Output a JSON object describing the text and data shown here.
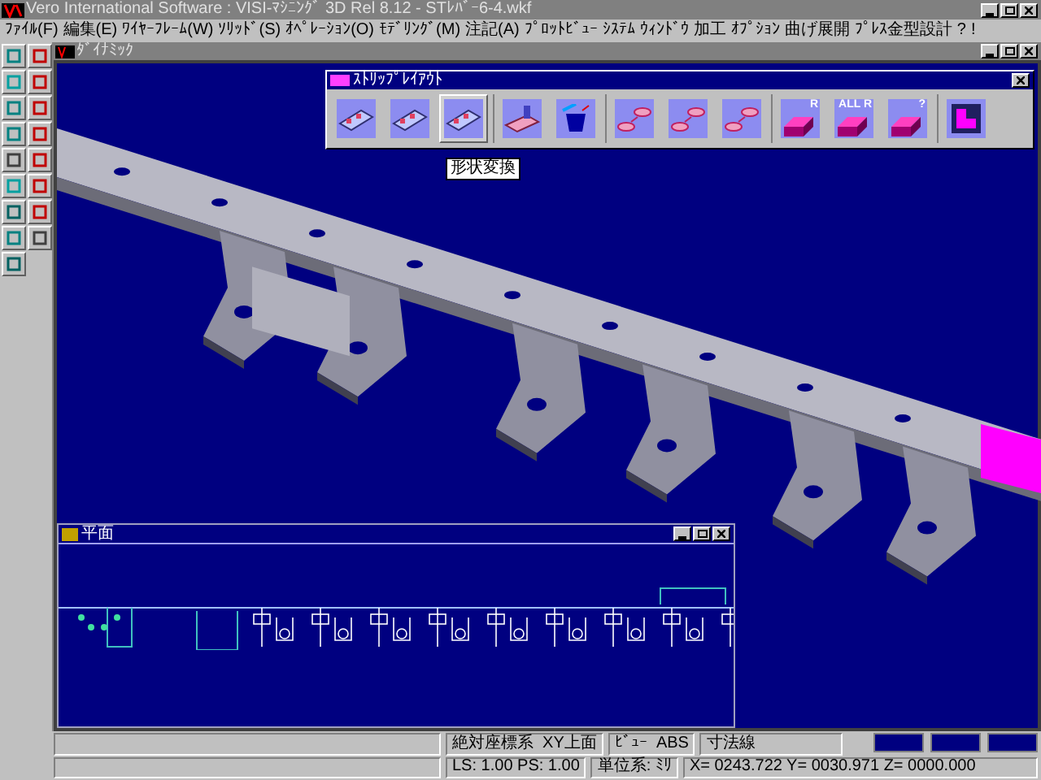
{
  "window": {
    "title": "Vero International Software : VISI-ﾏｼﾆﾝｸﾞ 3D Rel 8.12 - STﾚﾊﾞｰ6-4.wkf"
  },
  "menu": [
    "ﾌｧｲﾙ(F)",
    "編集(E)",
    "ﾜｲﾔｰﾌﾚｰﾑ(W)",
    "ｿﾘｯﾄﾞ(S)",
    "ｵﾍﾟﾚｰｼｮﾝ(O)",
    "ﾓﾃﾞﾘﾝｸﾞ(M)",
    "注記(A)",
    "ﾌﾟﾛｯﾄﾋﾞｭｰ",
    "ｼｽﾃﾑ",
    "ｳｨﾝﾄﾞｳ",
    "加工",
    "ｵﾌﾟｼｮﾝ",
    "曲げ展開",
    "ﾌﾟﾚｽ金型設計",
    "?",
    "!"
  ],
  "viewport": {
    "title": "ﾀﾞｲﾅﾐｯｸ"
  },
  "strip_toolbar": {
    "title": "ｽﾄﾘｯﾌﾟﾚｲｱｳﾄ",
    "tooltip": "形状変換",
    "groups": [
      [
        {
          "kind": "strip",
          "hovered": false
        },
        {
          "kind": "strip",
          "hovered": false
        },
        {
          "kind": "strip",
          "hovered": true
        }
      ],
      [
        {
          "kind": "tower",
          "hovered": false
        },
        {
          "kind": "bucket",
          "hovered": false
        }
      ],
      [
        {
          "kind": "pieces",
          "hovered": false
        },
        {
          "kind": "pieces",
          "hovered": false
        },
        {
          "kind": "pieces",
          "hovered": false
        }
      ],
      [
        {
          "kind": "block",
          "label": "R",
          "hovered": false
        },
        {
          "kind": "block",
          "label": "ALL R",
          "hovered": false
        },
        {
          "kind": "block",
          "label": "?",
          "hovered": false
        }
      ],
      [
        {
          "kind": "corner",
          "hovered": false
        }
      ]
    ]
  },
  "plan_window": {
    "title": "平面"
  },
  "status_bar": {
    "row_1": [
      "絶対座標系  XY上面",
      "ﾋﾞｭｰ  ABS",
      "寸法線"
    ],
    "row_2": [
      "LS: 1.00 PS: 1.00",
      "単位系: ﾐﾘ",
      "X= 0243.722 Y= 0030.971 Z= 0000.000"
    ]
  }
}
